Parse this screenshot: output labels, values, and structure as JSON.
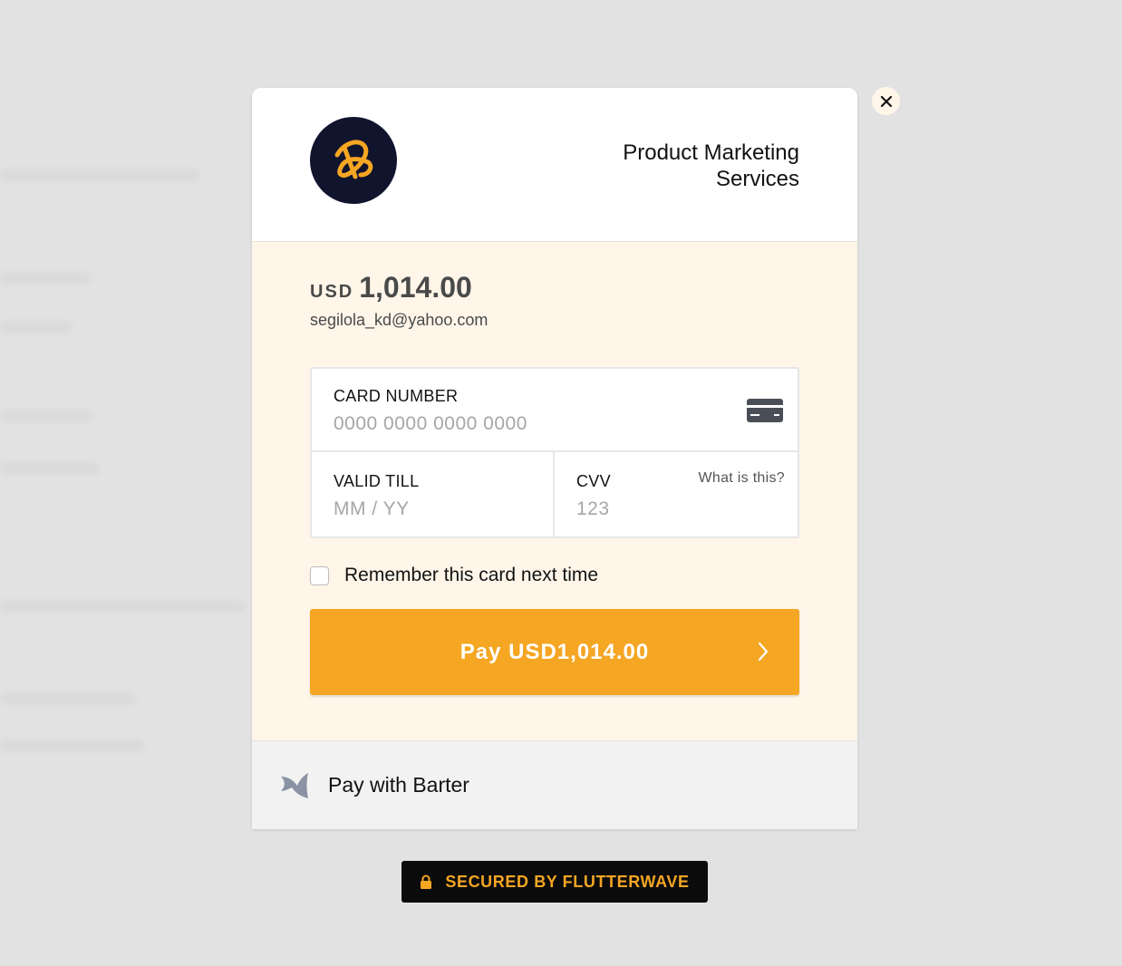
{
  "merchant": {
    "name": "Product Marketing Services"
  },
  "payment": {
    "currency": "USD",
    "amount": "1,014.00",
    "email": "segilola_kd@yahoo.com"
  },
  "card_form": {
    "card_number_label": "CARD NUMBER",
    "card_number_placeholder": "0000 0000 0000 0000",
    "valid_till_label": "VALID TILL",
    "valid_till_placeholder": "MM / YY",
    "cvv_label": "CVV",
    "cvv_placeholder": "123",
    "cvv_help_link": "What is this?"
  },
  "remember_card": {
    "label": "Remember this card next time",
    "checked": false
  },
  "pay_button": {
    "label": "Pay USD1,014.00"
  },
  "alternative_payment": {
    "label": "Pay with Barter"
  },
  "footer_badge": {
    "label": "SECURED BY FLUTTERWAVE"
  },
  "colors": {
    "accent": "#f5a623",
    "body_background": "#fff5e9",
    "logo_background": "#11142d",
    "badge_background": "#0b0b0b"
  },
  "icons": [
    "merchant-logo-icon",
    "card-icon",
    "chevron-right-icon",
    "barter-icon",
    "close-icon",
    "lock-icon"
  ]
}
